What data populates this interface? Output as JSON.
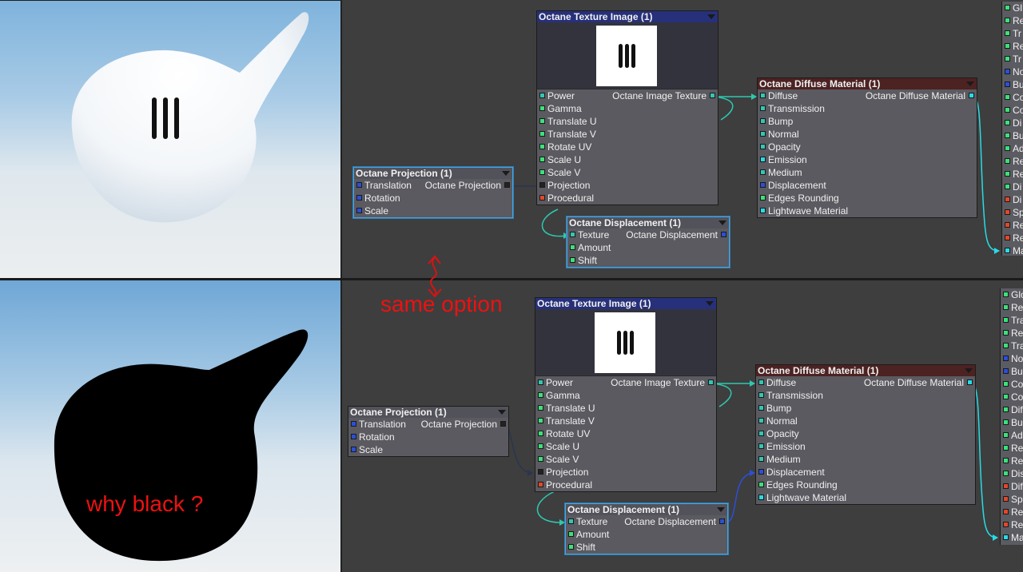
{
  "annotations": {
    "same_option": "same option",
    "why_black": "why black ?"
  },
  "nodes": {
    "texture_image": {
      "title": "Octane Texture Image (1)",
      "preview_icon": "III",
      "output": "Octane Image Texture",
      "inputs": [
        "Power",
        "Gamma",
        "Translate U",
        "Translate V",
        "Rotate UV",
        "Scale U",
        "Scale V",
        "Projection",
        "Procedural"
      ]
    },
    "projection": {
      "title": "Octane Projection (1)",
      "output": "Octane Projection",
      "inputs": [
        "Translation",
        "Rotation",
        "Scale"
      ]
    },
    "displacement": {
      "title": "Octane Displacement (1)",
      "output": "Octane Displacement",
      "inputs": [
        "Texture",
        "Amount",
        "Shift"
      ]
    },
    "diffuse": {
      "title": "Octane Diffuse Material (1)",
      "output": "Octane Diffuse Material",
      "inputs": [
        "Diffuse",
        "Transmission",
        "Bump",
        "Normal",
        "Opacity",
        "Emission",
        "Medium",
        "Displacement",
        "Edges Rounding",
        "Lightwave Material"
      ]
    }
  },
  "surface_strip": {
    "top": [
      "Gl",
      "Re",
      "Tr",
      "Re",
      "Tr",
      "No",
      "Bu",
      "Co",
      "Co",
      "Di",
      "Bu",
      "Ad",
      "Re",
      "Re",
      "Di",
      "Di",
      "Sp",
      "Re",
      "Re",
      "Ma"
    ],
    "bottom": [
      "Glo",
      "Re",
      "Tra",
      "Re",
      "Tra",
      "No",
      "Bu",
      "Co",
      "Co",
      "Dif",
      "Bu",
      "Ad",
      "Re",
      "Re",
      "Dis",
      "Dif",
      "Sp",
      "Re",
      "Re",
      "Ma"
    ]
  },
  "colors": {
    "wire": "#2ec8b0",
    "wire_dark": "#2a3550",
    "annotation": "#e11111",
    "selected_border": "#4aa3df"
  }
}
